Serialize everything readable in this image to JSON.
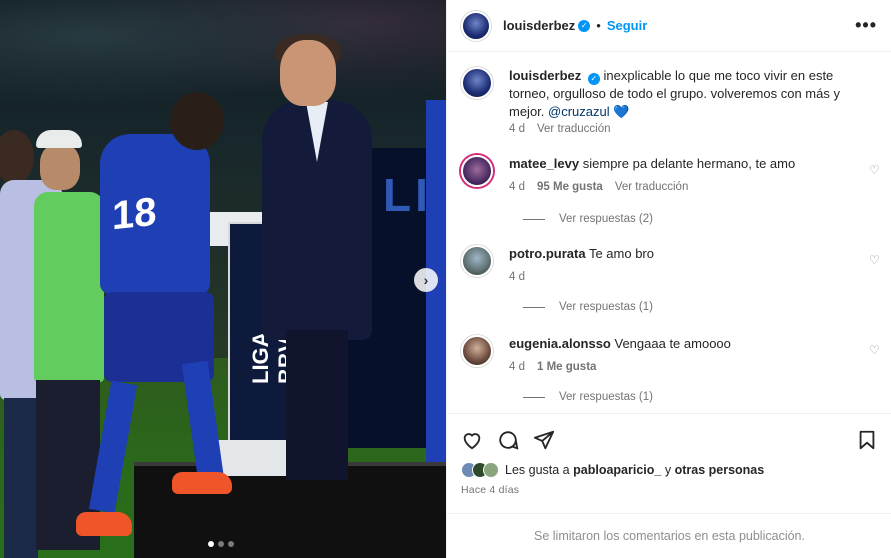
{
  "photo": {
    "jersey_number": "18",
    "billboard_text": "LIG",
    "podium_brand": "LIGA BBVA",
    "next_arrow": "›",
    "carousel_total": 3,
    "carousel_active": 1
  },
  "header": {
    "username": "louisderbez",
    "separator": "•",
    "follow_label": "Seguir",
    "more_label": "•••"
  },
  "caption": {
    "username": "louisderbez",
    "text": "inexplicable lo que me toco vivir en este torneo, orgulloso de todo el grupo. volveremos con más y mejor.",
    "mention": "@cruzazul",
    "emoji": "💙",
    "time": "4 d",
    "translate": "Ver traducción"
  },
  "comments": [
    {
      "username": "matee_levy",
      "text": "siempre pa delante hermano, te amo",
      "time": "4 d",
      "likes": "95 Me gusta",
      "translate": "Ver traducción",
      "replies": "Ver respuestas (2)"
    },
    {
      "username": "potro.purata",
      "text": "Te amo bro",
      "time": "4 d",
      "replies": "Ver respuestas (1)"
    },
    {
      "username": "eugenia.alonsso",
      "text": "Vengaaa te amoooo",
      "time": "4 d",
      "likes": "1 Me gusta",
      "replies": "Ver respuestas (1)"
    }
  ],
  "actions": {
    "likes_prefix": "Les gusta a",
    "likes_user": "pabloaparicio_",
    "likes_joiner": "y",
    "likes_others": "otras personas",
    "posted_ago": "Hace 4 días"
  },
  "footer": {
    "notice": "Se limitaron los comentarios en esta publicación."
  },
  "colors": {
    "link_blue": "#0095f6",
    "mention_blue": "#00376b",
    "muted_text": "#737373"
  }
}
